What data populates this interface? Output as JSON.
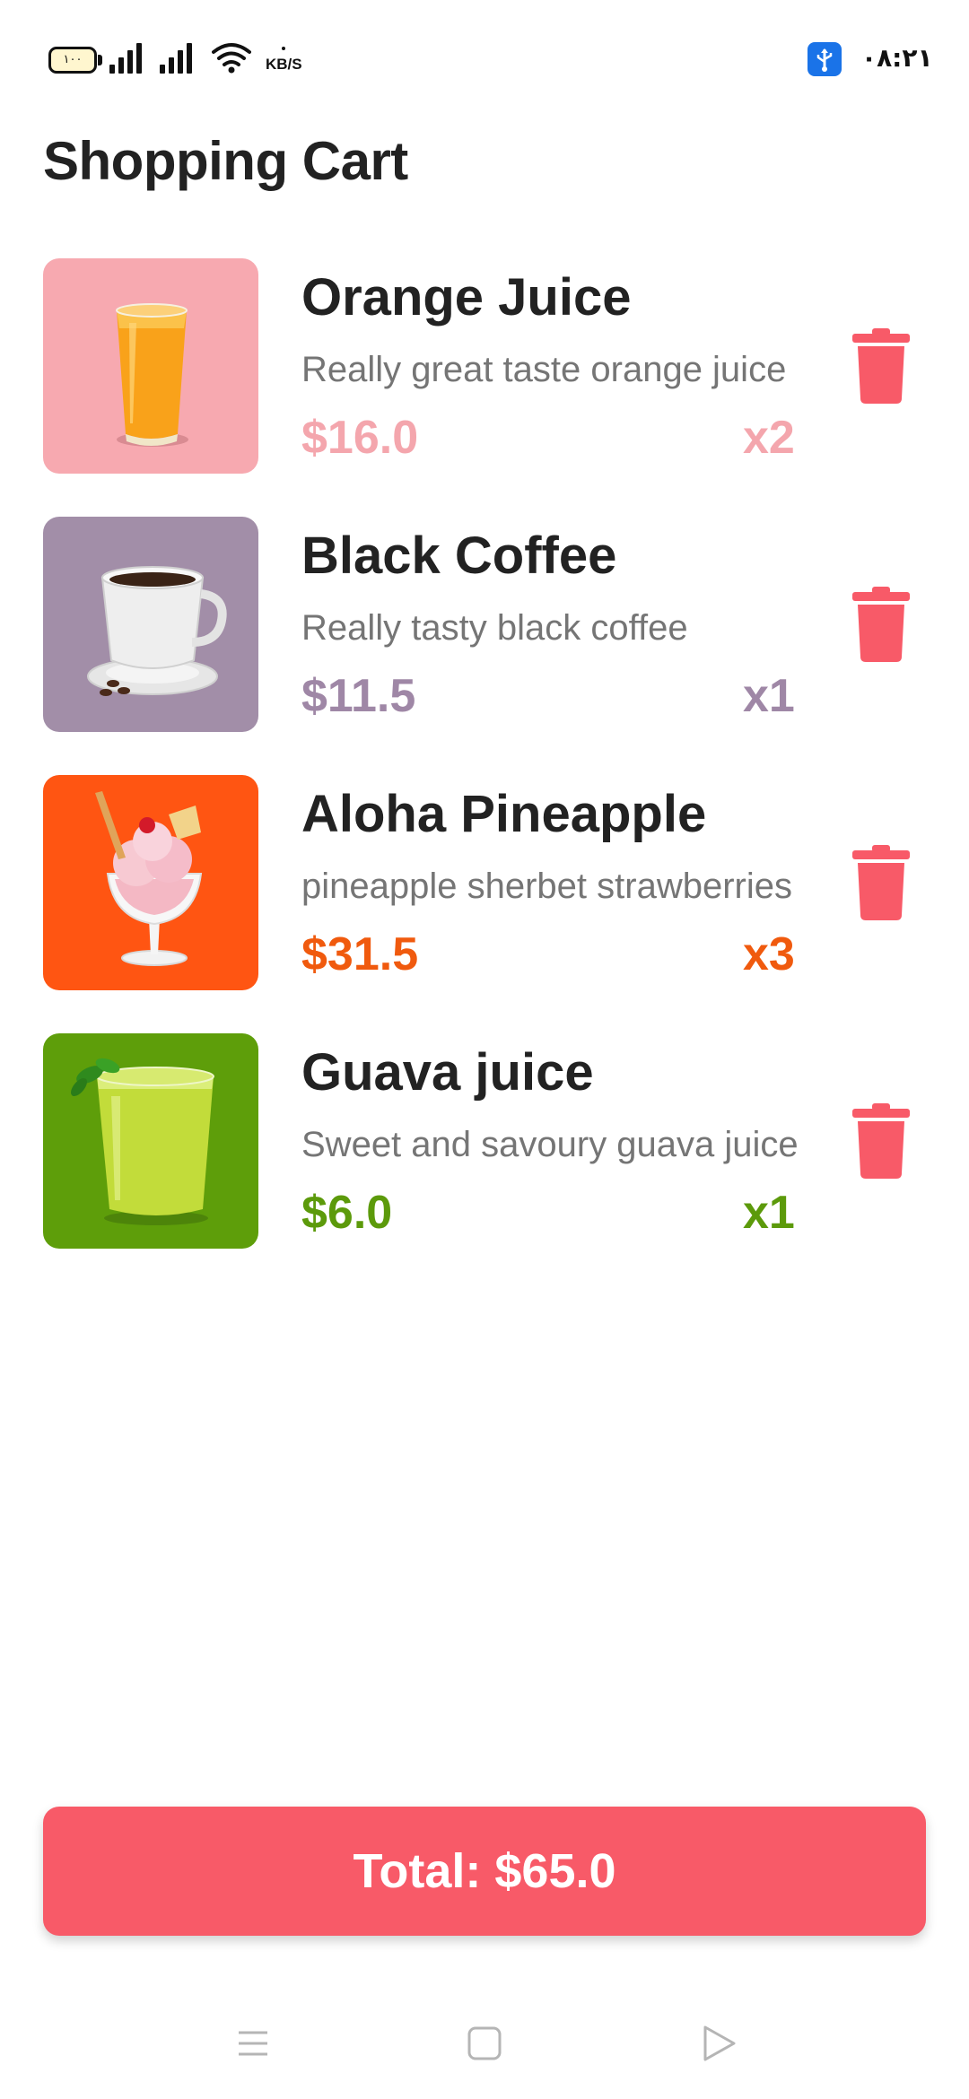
{
  "status_bar": {
    "battery": "١٠٠",
    "network_speed_unit": "KB/S",
    "time": "٠٨:٢١"
  },
  "page": {
    "title": "Shopping Cart"
  },
  "cart": {
    "items": [
      {
        "name": "Orange Juice",
        "description": "Really great taste orange juice",
        "price": "$16.0",
        "quantity": "x2",
        "accent_color": "#f4a6ad",
        "thumb_bg": "#f7a9b0",
        "image_icon": "orange-juice-glass"
      },
      {
        "name": "Black Coffee",
        "description": "Really tasty black coffee",
        "price": "$11.5",
        "quantity": "x1",
        "accent_color": "#9f87a6",
        "thumb_bg": "#a28ea8",
        "image_icon": "coffee-cup"
      },
      {
        "name": "Aloha Pineapple",
        "description": "pineapple sherbet strawberries",
        "price": "$31.5",
        "quantity": "x3",
        "accent_color": "#f05a0e",
        "thumb_bg": "#ff5512",
        "image_icon": "ice-cream-sundae"
      },
      {
        "name": "Guava juice",
        "description": "Sweet and savoury guava juice",
        "price": "$6.0",
        "quantity": "x1",
        "accent_color": "#5c9a0b",
        "thumb_bg": "#5e9e0a",
        "image_icon": "guava-smoothie-glass"
      }
    ],
    "delete_icon": "trash-icon",
    "delete_color": "#f85a68"
  },
  "total_button": {
    "label": "Total: $65.0",
    "color": "#f85a68"
  },
  "nav_bar": {
    "icons": [
      "menu-icon",
      "home-square-icon",
      "back-triangle-icon"
    ]
  }
}
